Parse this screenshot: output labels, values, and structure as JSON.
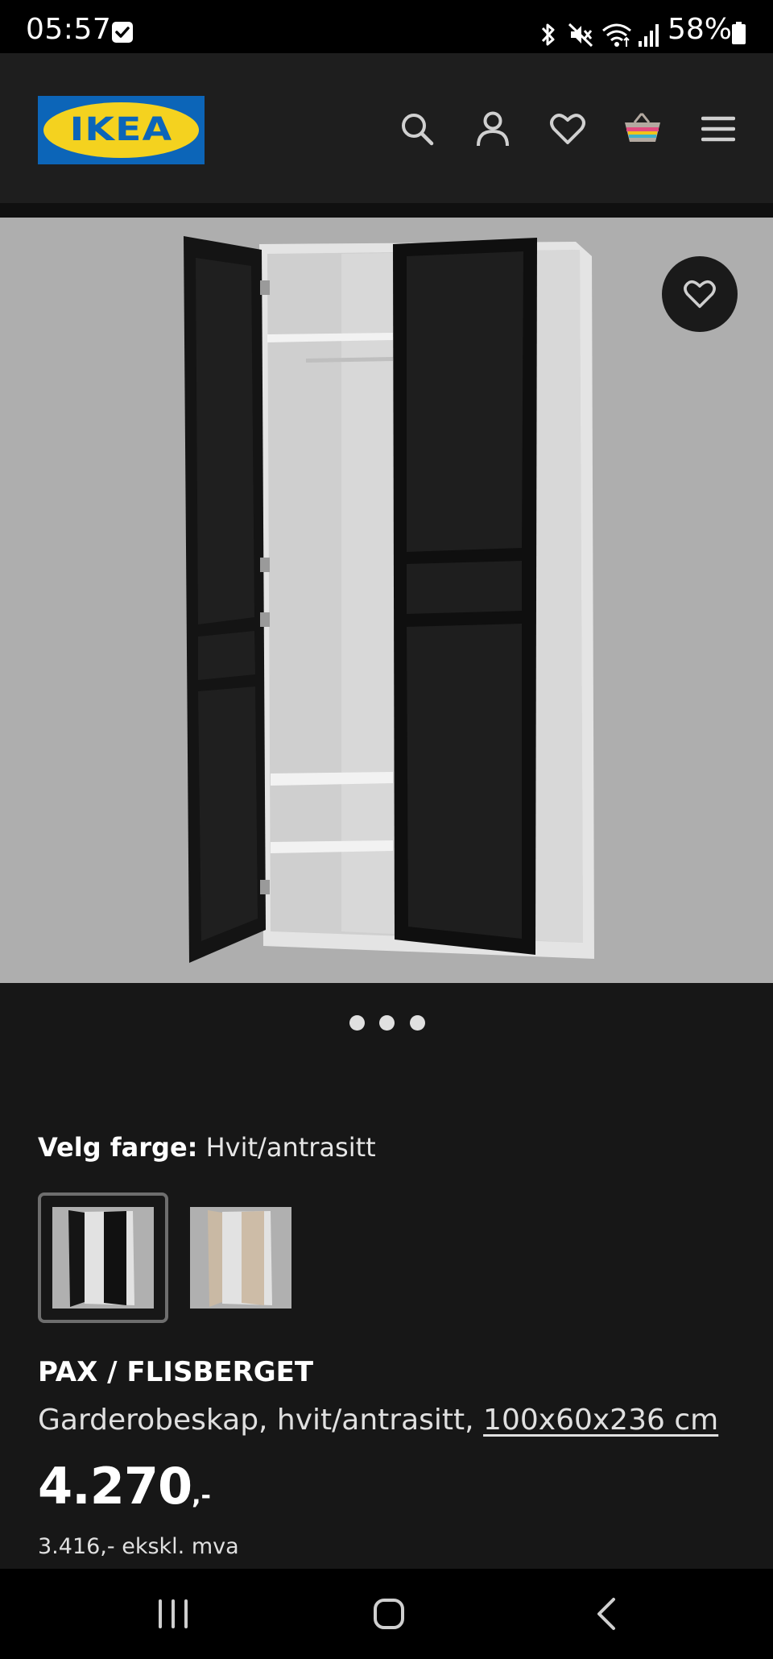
{
  "status_bar": {
    "time": "05:57",
    "battery": "58%",
    "icons": [
      "check-notification-icon",
      "bluetooth-icon",
      "mute-icon",
      "wifi-icon",
      "signal-icon",
      "battery-icon"
    ]
  },
  "header": {
    "logo_text": "IKEA",
    "icons": [
      "search-icon",
      "account-icon",
      "wishlist-heart-icon",
      "basket-icon",
      "menu-icon"
    ],
    "colors": {
      "logo_blue": "#0c65b8",
      "logo_yellow": "#f4d21f"
    }
  },
  "gallery": {
    "favourite_icon": "heart-icon",
    "image_count": 3,
    "active_index": 0
  },
  "color_select": {
    "label": "Velg farge:",
    "value": "Hvit/antrasitt",
    "options": [
      {
        "name": "white-anthracite",
        "selected": true
      },
      {
        "name": "white-beige",
        "selected": false
      }
    ]
  },
  "product": {
    "name": "PAX / FLISBERGET",
    "description": "Garderobeskap, hvit/antrasitt,",
    "measurement": "100x60x236 cm",
    "price_integer": "4.270",
    "price_suffix": ",-",
    "price_excl_vat": "3.416,- ekskl. mva"
  },
  "nav_bar": {
    "buttons": [
      "recent-apps-icon",
      "home-icon",
      "back-icon"
    ]
  }
}
